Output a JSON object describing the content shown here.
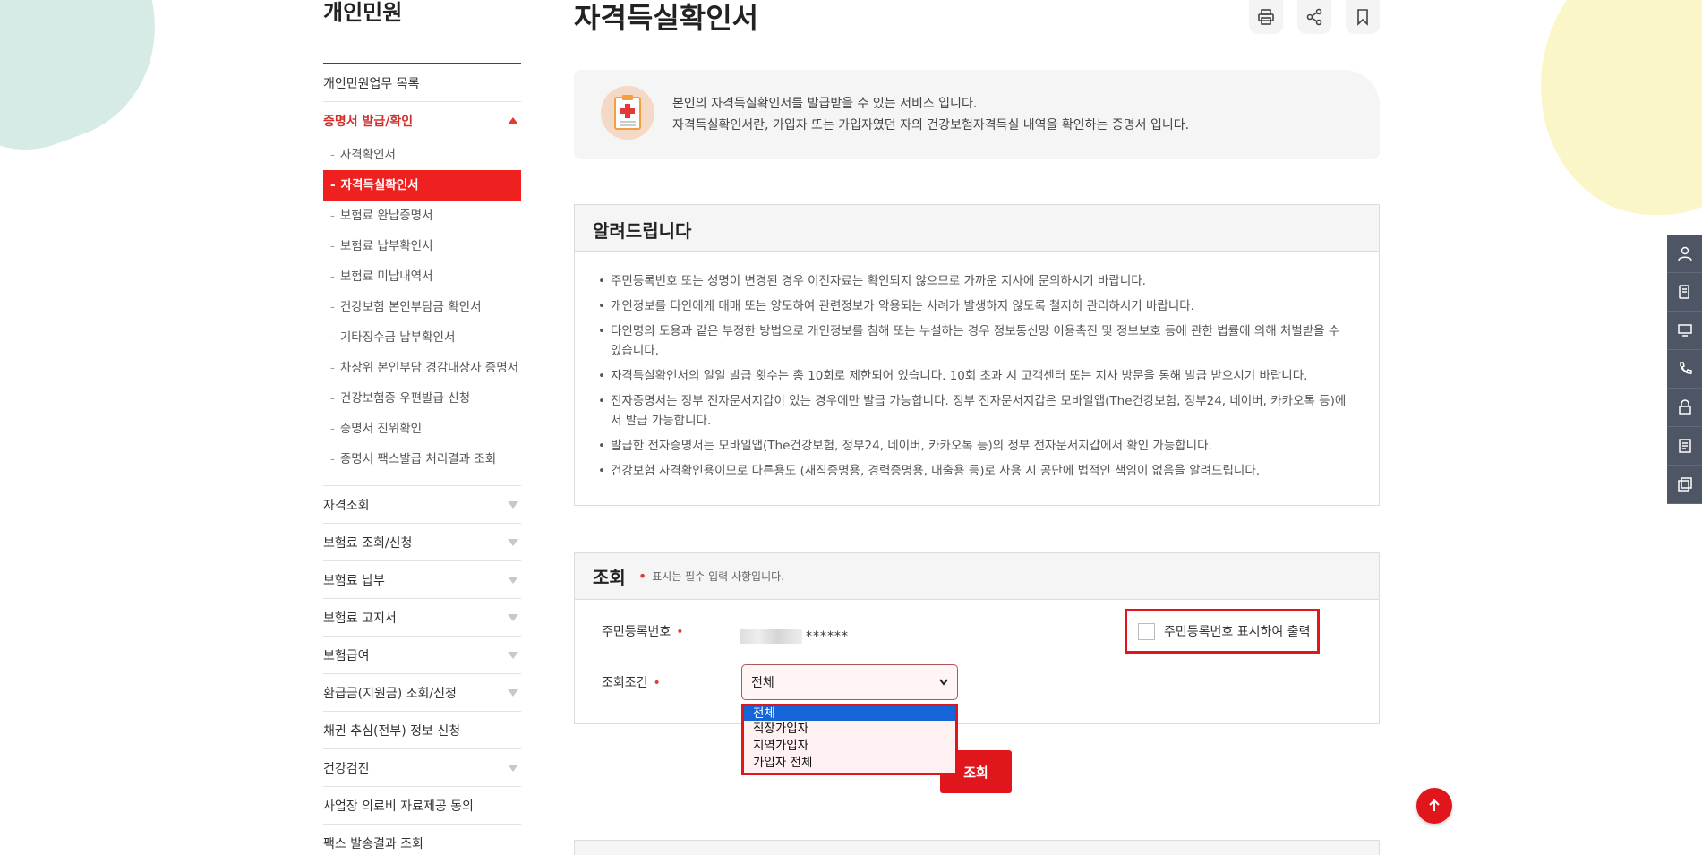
{
  "nav": {
    "title": "개인민원",
    "top_item": "개인민원업무 목록",
    "active_section": "증명서 발급/확인",
    "sub_items": [
      "자격확인서",
      "자격득실확인서",
      "보험료 완납증명서",
      "보험료 납부확인서",
      "보험료 미납내역서",
      "건강보험 본인부담금 확인서",
      "기타징수금 납부확인서",
      "차상위 본인부담 경감대상자 증명서",
      "건강보험증 우편발급 신청",
      "증명서 진위확인",
      "증명서 팩스발급 처리결과 조회"
    ],
    "active_sub_index": 1,
    "sections": [
      {
        "label": "자격조회",
        "expandable": true
      },
      {
        "label": "보험료 조회/신청",
        "expandable": true
      },
      {
        "label": "보험료 납부",
        "expandable": true
      },
      {
        "label": "보험료 고지서",
        "expandable": true
      },
      {
        "label": "보험급여",
        "expandable": true
      },
      {
        "label": "환급금(지원금) 조회/신청",
        "expandable": true
      },
      {
        "label": "채권 추심(전부) 정보 신청",
        "expandable": false
      },
      {
        "label": "건강검진",
        "expandable": true
      },
      {
        "label": "사업장 의료비 자료제공 동의",
        "expandable": false
      },
      {
        "label": "팩스 발송결과 조회",
        "expandable": false
      }
    ]
  },
  "page": {
    "title": "자격득실확인서",
    "tools": [
      "print-icon",
      "share-icon",
      "bookmark-icon"
    ]
  },
  "intro": {
    "line1": "본인의 자격득실확인서를 발급받을 수 있는 서비스 입니다.",
    "line2": "자격득실확인서란, 가입자 또는 가입자였던 자의 건강보험자격득실 내역을 확인하는 증명서 입니다."
  },
  "notice": {
    "title": "알려드립니다",
    "items": [
      "주민등록번호 또는 성명이 변경된 경우 이전자료는 확인되지 않으므로 가까운 지사에 문의하시기 바랍니다.",
      "개인정보를 타인에게 매매 또는 양도하여 관련정보가 악용되는 사례가 발생하지 않도록 철저히 관리하시기 바랍니다.",
      "타인명의 도용과 같은 부정한 방법으로 개인정보를 침해 또는 누설하는 경우 정보통신망 이용촉진 및 정보보호 등에 관한 법률에 의해 처벌받을 수 있습니다.",
      "자격득실확인서의 일일 발급 횟수는 총 10회로 제한되어 있습니다. 10회 초과 시 고객센터 또는 지사 방문을 통해 발급 받으시기 바랍니다.",
      "전자증명서는 정부 전자문서지갑이 있는 경우에만 발급 가능합니다. 정부 전자문서지갑은 모바일앱(The건강보험, 정부24, 네이버, 카카오톡 등)에서 발급 가능합니다.",
      "발급한 전자증명서는 모바일앱(The건강보험, 정부24, 네이버, 카카오톡 등)의 정부 전자문서지갑에서 확인 가능합니다.",
      "건강보험 자격확인용이므로 다른용도 (재직증명용, 경력증명용, 대출용 등)로 사용 시 공단에 법적인 책임이 없음을 알려드립니다."
    ]
  },
  "query": {
    "title": "조회",
    "required_note": "표시는 필수 입력 사항입니다.",
    "rrn_label": "주민등록번호",
    "rrn_masked": "******",
    "show_rrn_label": "주민등록번호 표시하여 출력",
    "condition_label": "조회조건",
    "condition_value": "전체",
    "options": [
      "전체",
      "직장가입자",
      "지역가입자",
      "가입자 전체"
    ],
    "search_button": "조회"
  },
  "colors": {
    "accent": "#e0161c",
    "active_sub_bg": "#ef2020",
    "quickbar": "#4e5564",
    "select_highlight": "#1565d8"
  },
  "quickbar": [
    "user-icon",
    "phone-doc-icon",
    "monitor-icon",
    "phone-icon",
    "lock-icon",
    "document-icon",
    "copy-icon"
  ]
}
